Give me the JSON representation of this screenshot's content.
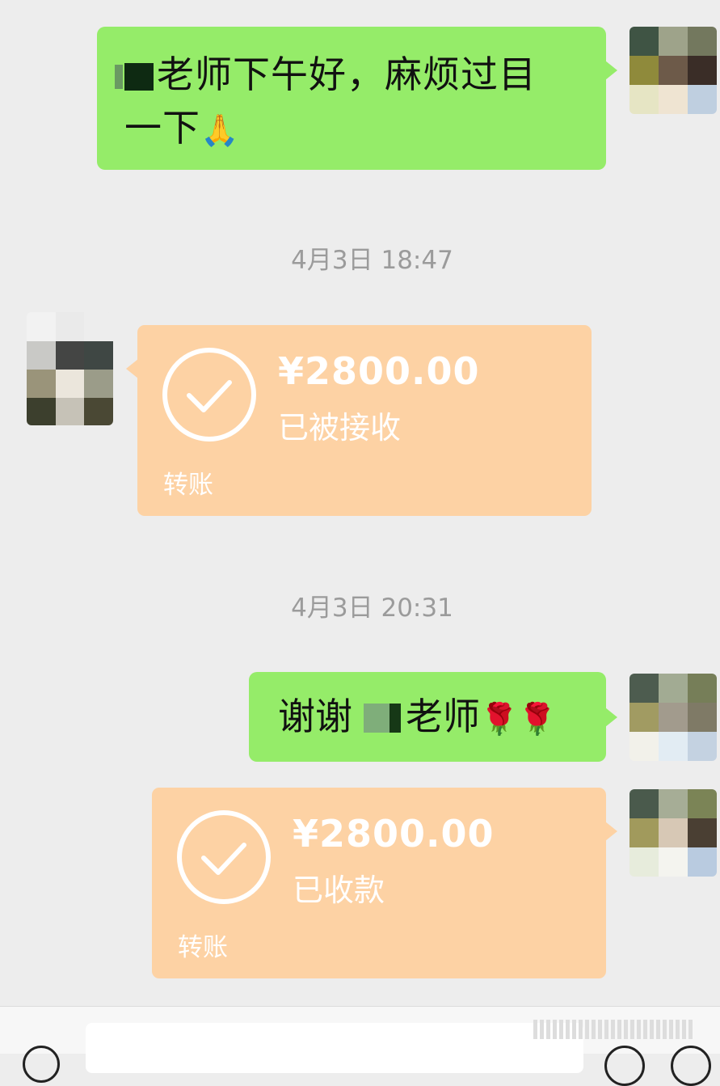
{
  "messages": [
    {
      "id": "msg1",
      "text_main": "老师下午好，麻烦过目",
      "text_line2": "一下",
      "emoji": "🙏"
    },
    {
      "id": "msg3",
      "text_before": "谢谢",
      "text_after": "老师",
      "emoji": "🌹🌹"
    }
  ],
  "timestamps": [
    "4月3日 18:47",
    "4月3日 20:31"
  ],
  "transfers": [
    {
      "amount": "¥2800.00",
      "status": "已被接收",
      "label": "转账"
    },
    {
      "amount": "¥2800.00",
      "status": "已收款",
      "label": "转账"
    }
  ],
  "colors": {
    "chat_background": "#ededed",
    "self_bubble": "#95ec69",
    "transfer_card": "#fdd2a4",
    "timestamp_text": "#9b9b9b"
  },
  "icons": {
    "transfer_status": "check-circle-icon",
    "input_bar_left": "voice-icon",
    "input_bar_right": [
      "emoji-icon",
      "plus-icon"
    ]
  }
}
